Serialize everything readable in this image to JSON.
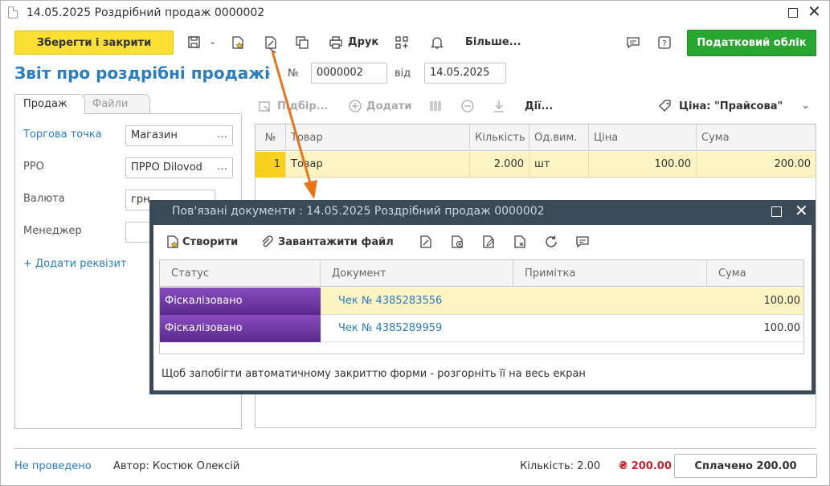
{
  "window": {
    "title": "14.05.2025 Роздрібний продаж 0000002"
  },
  "toolbar": {
    "save_close": "Зберегти і закрити",
    "print": "Друк",
    "more": "Більше...",
    "tax": "Податковий облік"
  },
  "form": {
    "title": "Звіт про роздрібні продажі",
    "num_label": "№",
    "num_value": "0000002",
    "date_label": "від",
    "date_value": "14.05.2025"
  },
  "left": {
    "tabs": [
      "Продаж",
      "Файли"
    ],
    "fields": [
      {
        "label": "Торгова точка",
        "value": "Магазин"
      },
      {
        "label": "РРО",
        "value": "ПРРО Dilovod"
      },
      {
        "label": "Валюта",
        "value": "грн"
      },
      {
        "label": "Менеджер",
        "value": ""
      }
    ],
    "add_attr": "+ Додати реквізит"
  },
  "right": {
    "pick": "Підбір...",
    "add": "Додати",
    "actions": "Дії...",
    "price": "Ціна: \"Прайсова\"",
    "columns": [
      "№",
      "Товар",
      "Кількість",
      "Од.вим.",
      "Ціна",
      "Сума"
    ],
    "rows": [
      {
        "n": "1",
        "item": "Товар",
        "qty": "2.000",
        "unit": "шт",
        "price": "100.00",
        "sum": "200.00"
      }
    ]
  },
  "footer": {
    "status": "Не проведено",
    "author": "Автор: Костюк Олексій",
    "qty": "Кількість: 2.00",
    "total": "₴ 200.00",
    "paid": "Сплачено 200.00"
  },
  "modal": {
    "title": "Пов'язані документи : 14.05.2025 Роздрібний продаж 0000002",
    "create": "Створити",
    "upload": "Завантажити файл",
    "columns": [
      "Статус",
      "Документ",
      "Примітка",
      "Сума"
    ],
    "rows": [
      {
        "status": "Фіскалізовано",
        "doc": "Чек № 4385283556",
        "note": "",
        "sum": "100.00"
      },
      {
        "status": "Фіскалізовано",
        "doc": "Чек № 4385289959",
        "note": "",
        "sum": "100.00"
      }
    ],
    "note": "Щоб запобігти автоматичному закриттю форми - розгорніть її на весь екран"
  },
  "colors": {
    "accent_blue": "#2b7dbd",
    "save_yellow": "#fbe033",
    "tax_green": "#27a630",
    "status_purple": "#6a35a0",
    "arrow_orange": "#e8751a",
    "total_red": "#c0262c"
  }
}
